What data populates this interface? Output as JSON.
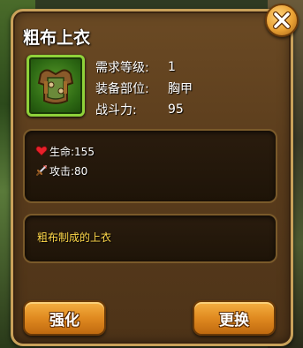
{
  "item": {
    "name": "粗布上衣",
    "icon": "chest-armor-icon",
    "stats": [
      {
        "label": "需求等级:",
        "value": "1"
      },
      {
        "label": "装备部位:",
        "value": "胸甲"
      },
      {
        "label": "战斗力:",
        "value": "95"
      }
    ]
  },
  "attributes": [
    {
      "icon": "heart-icon",
      "label": "生命:155"
    },
    {
      "icon": "sword-icon",
      "label": "攻击:80"
    }
  ],
  "description": "粗布制成的上衣",
  "buttons": {
    "enhance": "强化",
    "replace": "更换"
  },
  "colors": {
    "panel": "#5a3c1c",
    "border": "#c9a15a",
    "description_text": "#ffd84a",
    "button": "#e08a20",
    "item_frame": "#8fd23a"
  }
}
